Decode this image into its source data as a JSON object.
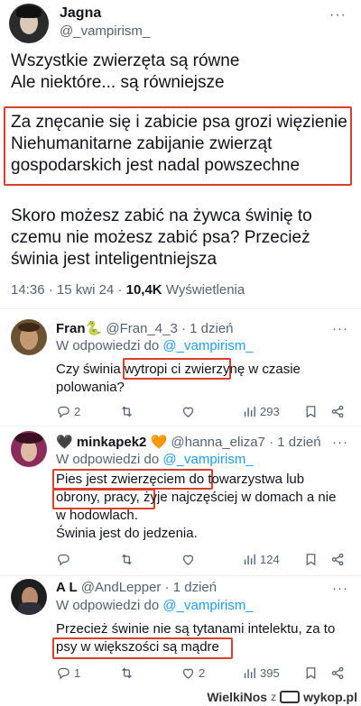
{
  "main_post": {
    "author_name": "Jagna",
    "author_handle": "@_vampirism_",
    "more_label": "···",
    "para1": [
      "Wszystkie zwierzęta są równe",
      "Ale niektóre... są równiejsze"
    ],
    "para2": [
      "Za znęcanie się i zabicie psa grozi więzienie",
      "Niehumanitarne zabijanie zwierząt",
      "gospodarskich jest nadal powszechne"
    ],
    "para3": [
      "Skoro możesz zabić na żywca świnię to",
      "czemu nie możesz zabić psa? Przecież",
      "świnia jest inteligentniejsza"
    ],
    "time": "14:36",
    "date": "15 kwi 24",
    "views_count": "10,4K",
    "views_label": "Wyświetlenia"
  },
  "replies": [
    {
      "name": "Fran🐍",
      "handle": "@Fran_4_3",
      "age": "1 dzień",
      "reply_prefix": "W odpowiedzi do",
      "reply_to": "@_vampirism_",
      "lines": [
        "Czy świnia wytropi ci zwierzynę w czasie",
        "polowania?"
      ],
      "replies": "2",
      "reposts": "",
      "likes": "",
      "views": "293"
    },
    {
      "name": "🖤 minkapek2 🧡",
      "handle": "@hanna_eliza7",
      "age": "1 dzień",
      "reply_prefix": "W odpowiedzi do",
      "reply_to": "@_vampirism_",
      "lines": [
        "Pies jest zwierzęciem do towarzystwa lub",
        "obrony, pracy, żyje najczęściej w domach a nie",
        "w hodowlach.",
        "Świnia jest do jedzenia."
      ],
      "replies": "",
      "reposts": "",
      "likes": "",
      "views": "124"
    },
    {
      "name": "A L",
      "handle": "@AndLepper",
      "age": "1 dzień",
      "reply_prefix": "W odpowiedzi do",
      "reply_to": "@_vampirism_",
      "lines": [
        "Przecież świnie nie są tytanami intelektu, za to",
        "psy w większości są mądre"
      ],
      "replies": "1",
      "reposts": "",
      "likes": "2",
      "views": "395"
    }
  ],
  "footer": {
    "text": "WielkiNos",
    "z": "z",
    "site": "wykop.pl"
  },
  "colors": {
    "highlight_box": "#d9402c",
    "link": "#1d9bf0",
    "secondary_text": "#536471"
  }
}
